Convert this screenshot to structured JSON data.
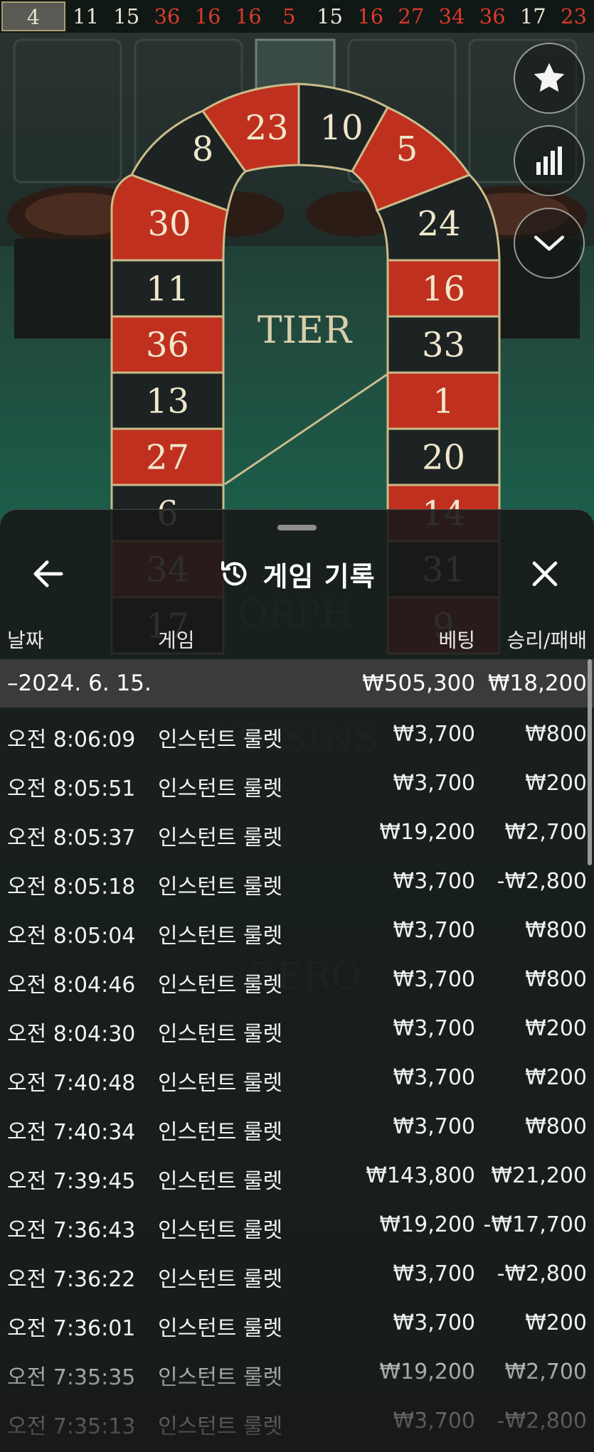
{
  "results_strip": {
    "current": "4",
    "numbers": [
      {
        "n": "11",
        "color": "black"
      },
      {
        "n": "15",
        "color": "black"
      },
      {
        "n": "36",
        "color": "red"
      },
      {
        "n": "16",
        "color": "red"
      },
      {
        "n": "16",
        "color": "red"
      },
      {
        "n": "5",
        "color": "red"
      },
      {
        "n": "15",
        "color": "black"
      },
      {
        "n": "16",
        "color": "red"
      },
      {
        "n": "27",
        "color": "red"
      },
      {
        "n": "34",
        "color": "red"
      },
      {
        "n": "36",
        "color": "red"
      },
      {
        "n": "17",
        "color": "black"
      },
      {
        "n": "23",
        "color": "red"
      }
    ]
  },
  "racetrack": {
    "center_label": "TIER",
    "faded_labels": [
      "ORPH",
      "VOISINS",
      "ZERO"
    ],
    "top_numbers": [
      "23",
      "10"
    ],
    "left_numbers": [
      "8",
      "30",
      "11",
      "36",
      "13",
      "27",
      "6",
      "34",
      "17"
    ],
    "right_numbers": [
      "5",
      "24",
      "16",
      "33",
      "1",
      "20",
      "14",
      "31",
      "9"
    ]
  },
  "side_buttons": {
    "favorite_icon": "star-icon",
    "stats_icon": "bar-chart-icon",
    "collapse_icon": "chevron-down-icon"
  },
  "sheet": {
    "title": "게임 기록",
    "back_icon": "arrow-left-icon",
    "history_icon": "history-icon",
    "close_icon": "close-icon"
  },
  "columns": {
    "date": "날짜",
    "game": "게임",
    "bet": "베팅",
    "result": "승리/패배"
  },
  "date_summary": {
    "date": "–2024. 6. 15.",
    "bet_total": "₩505,300",
    "result_total": "₩18,200"
  },
  "rows": [
    {
      "time": "오전 8:06:09",
      "game": "인스턴트 룰렛",
      "bet": "₩3,700",
      "result": "₩800"
    },
    {
      "time": "오전 8:05:51",
      "game": "인스턴트 룰렛",
      "bet": "₩3,700",
      "result": "₩200"
    },
    {
      "time": "오전 8:05:37",
      "game": "인스턴트 룰렛",
      "bet": "₩19,200",
      "result": "₩2,700"
    },
    {
      "time": "오전 8:05:18",
      "game": "인스턴트 룰렛",
      "bet": "₩3,700",
      "result": "-₩2,800"
    },
    {
      "time": "오전 8:05:04",
      "game": "인스턴트 룰렛",
      "bet": "₩3,700",
      "result": "₩800"
    },
    {
      "time": "오전 8:04:46",
      "game": "인스턴트 룰렛",
      "bet": "₩3,700",
      "result": "₩800"
    },
    {
      "time": "오전 8:04:30",
      "game": "인스턴트 룰렛",
      "bet": "₩3,700",
      "result": "₩200"
    },
    {
      "time": "오전 7:40:48",
      "game": "인스턴트 룰렛",
      "bet": "₩3,700",
      "result": "₩200"
    },
    {
      "time": "오전 7:40:34",
      "game": "인스턴트 룰렛",
      "bet": "₩3,700",
      "result": "₩800"
    },
    {
      "time": "오전 7:39:45",
      "game": "인스턴트 룰렛",
      "bet": "₩143,800",
      "result": "₩21,200"
    },
    {
      "time": "오전 7:36:43",
      "game": "인스턴트 룰렛",
      "bet": "₩19,200",
      "result": "-₩17,700"
    },
    {
      "time": "오전 7:36:22",
      "game": "인스턴트 룰렛",
      "bet": "₩3,700",
      "result": "-₩2,800"
    },
    {
      "time": "오전 7:36:01",
      "game": "인스턴트 룰렛",
      "bet": "₩3,700",
      "result": "₩200"
    },
    {
      "time": "오전 7:35:35",
      "game": "인스턴트 룰렛",
      "bet": "₩19,200",
      "result": "₩2,700"
    },
    {
      "time": "오전 7:35:13",
      "game": "인스턴트 룰렛",
      "bet": "₩3,700",
      "result": "-₩2,800"
    }
  ],
  "colors": {
    "red_pocket": "#c0301f",
    "black_pocket": "#1d2322",
    "gold_border": "#c9bc8a",
    "felt_green": "#1b5f4b",
    "sheet_bg": "#181919"
  }
}
